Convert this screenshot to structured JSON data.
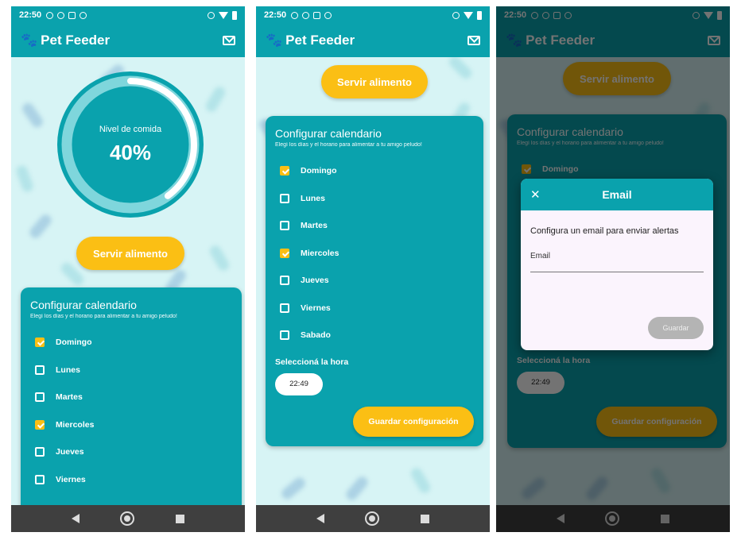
{
  "status": {
    "time": "22:50"
  },
  "app": {
    "title": "Pet Feeder"
  },
  "gauge": {
    "label": "Nivel de comida",
    "value_text": "40%",
    "fill_fraction": 0.4
  },
  "serve_button": "Servir alimento",
  "calendar": {
    "title": "Configurar calendario",
    "subtitle": "Elegí los días y el horario para alimentar a tu amigo peludo!",
    "days": [
      {
        "label": "Domingo",
        "checked": true
      },
      {
        "label": "Lunes",
        "checked": false
      },
      {
        "label": "Martes",
        "checked": false
      },
      {
        "label": "Miercoles",
        "checked": true
      },
      {
        "label": "Jueves",
        "checked": false
      },
      {
        "label": "Viernes",
        "checked": false
      },
      {
        "label": "Sabado",
        "checked": false
      }
    ],
    "time_label": "Seleccioná la hora",
    "time_value": "22:49",
    "save_button": "Guardar configuración"
  },
  "email_dialog": {
    "title": "Email",
    "message": "Configura un email para enviar alertas",
    "field_label": "Email",
    "save_button": "Guardar"
  },
  "colors": {
    "teal": "#0aa2ad",
    "yellow": "#fbbf14",
    "background": "#d7f4f5"
  }
}
